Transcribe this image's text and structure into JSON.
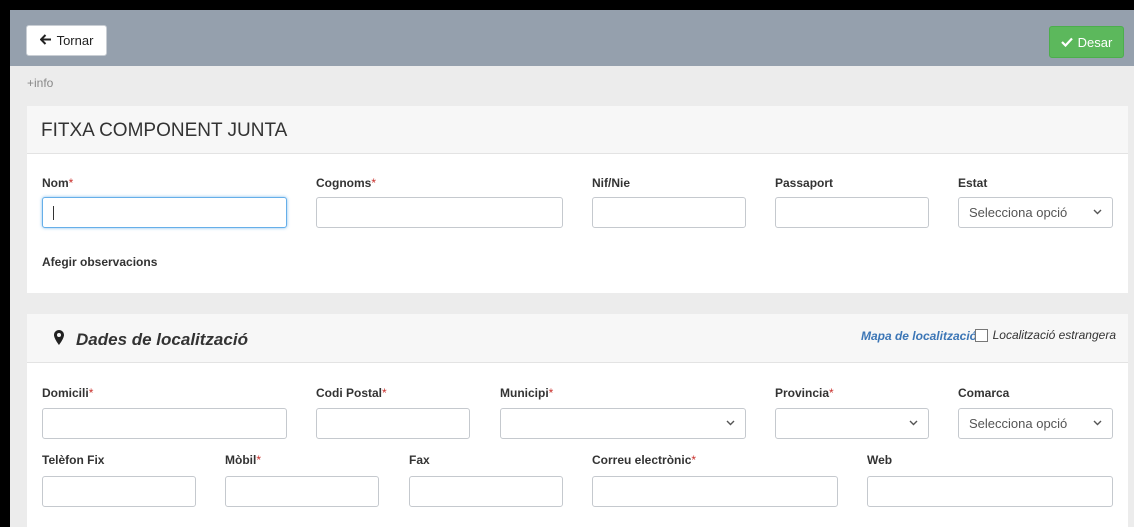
{
  "toolbar": {
    "back_label": "Tornar",
    "save_label": "Desar"
  },
  "info_link": "+info",
  "fitxa": {
    "title": "FITXA COMPONENT JUNTA",
    "fields": {
      "nom": "Nom",
      "cognoms": "Cognoms",
      "nif": "Nif/Nie",
      "passaport": "Passaport",
      "estat": "Estat",
      "estat_placeholder": "Selecciona opció"
    },
    "observacions": "Afegir observacions"
  },
  "localitzacio": {
    "title": "Dades de localització",
    "map_link": "Mapa de localització",
    "foreign_label": "Localització estrangera",
    "fields": {
      "domicili": "Domicili",
      "codi_postal": "Codi Postal",
      "municipi": "Municipi",
      "provincia": "Provincia",
      "comarca": "Comarca",
      "comarca_placeholder": "Selecciona opció",
      "telefon": "Telèfon Fix",
      "mobil": "Mòbil",
      "fax": "Fax",
      "correu": "Correu electrònic",
      "web": "Web"
    }
  },
  "required_marker": "*",
  "colors": {
    "topbar": "#95a0ad",
    "save": "#5cb85c",
    "required": "#c9302c",
    "link": "#3c76b6"
  }
}
